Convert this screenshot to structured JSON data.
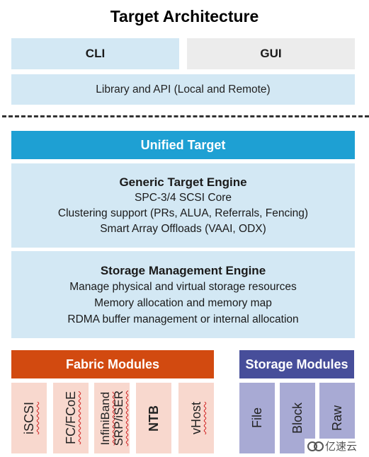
{
  "title": "Target Architecture",
  "top": {
    "cli": "CLI",
    "gui": "GUI",
    "library": "Library and API (Local and Remote)"
  },
  "unified_target": "Unified Target",
  "generic_engine": {
    "heading": "Generic Target Engine",
    "lines": [
      "SPC-3/4 SCSI Core",
      "Clustering support (PRs, ALUA, Referrals, Fencing)",
      "Smart Array Offloads (VAAI, ODX)"
    ]
  },
  "storage_engine": {
    "heading": "Storage Management Engine",
    "lines": [
      "Manage physical and virtual storage resources",
      "Memory allocation and memory map",
      "RDMA buffer management or internal allocation"
    ]
  },
  "fabric_modules": {
    "heading": "Fabric Modules",
    "items": [
      [
        "iSCSI"
      ],
      [
        "FC/FCoE"
      ],
      [
        "InfiniBand",
        "SRP/iSER"
      ],
      [
        "NTB"
      ],
      [
        "vHost"
      ]
    ]
  },
  "storage_modules": {
    "heading": "Storage Modules",
    "items": [
      "File",
      "Block",
      "Raw"
    ]
  },
  "watermark": "亿速云",
  "colors": {
    "light_blue": "#d3e8f4",
    "grey": "#ececec",
    "unified_blue": "#1ea0d3",
    "fabric_orange": "#d24a10",
    "fabric_light": "#f8d8ce",
    "storage_navy": "#474e9a",
    "storage_light": "#a8aad4"
  }
}
